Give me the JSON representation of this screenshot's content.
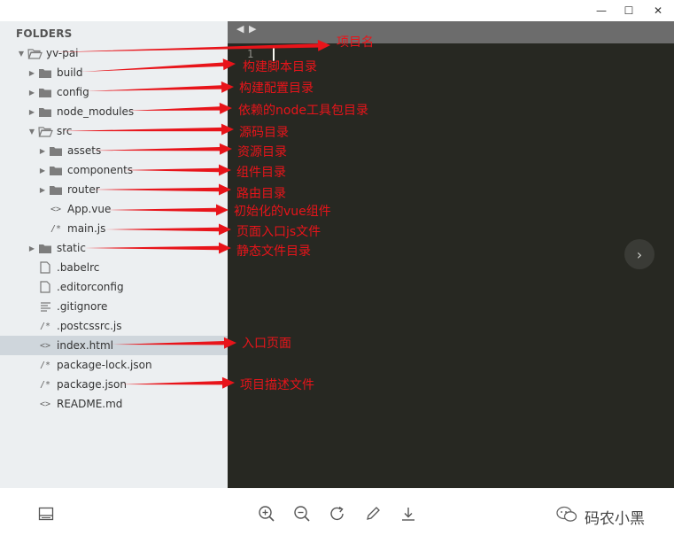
{
  "window": {
    "minimize_glyph": "—",
    "maximize_glyph": "☐",
    "close_glyph": "✕"
  },
  "sidebar": {
    "title": "FOLDERS",
    "items": [
      {
        "label": "yv-pai",
        "kind": "folder-open",
        "depth": 0
      },
      {
        "label": "build",
        "kind": "folder",
        "depth": 1
      },
      {
        "label": "config",
        "kind": "folder",
        "depth": 1
      },
      {
        "label": "node_modules",
        "kind": "folder",
        "depth": 1
      },
      {
        "label": "src",
        "kind": "folder-open",
        "depth": 1
      },
      {
        "label": "assets",
        "kind": "folder",
        "depth": 2
      },
      {
        "label": "components",
        "kind": "folder",
        "depth": 2
      },
      {
        "label": "router",
        "kind": "folder",
        "depth": 2
      },
      {
        "label": "App.vue",
        "kind": "markup",
        "depth": 2
      },
      {
        "label": "main.js",
        "kind": "script",
        "depth": 2
      },
      {
        "label": "static",
        "kind": "folder",
        "depth": 1
      },
      {
        "label": ".babelrc",
        "kind": "file",
        "depth": 1
      },
      {
        "label": ".editorconfig",
        "kind": "file",
        "depth": 1
      },
      {
        "label": ".gitignore",
        "kind": "text",
        "depth": 1
      },
      {
        "label": ".postcssrc.js",
        "kind": "script",
        "depth": 1
      },
      {
        "label": "index.html",
        "kind": "markup",
        "depth": 1,
        "selected": true
      },
      {
        "label": "package-lock.json",
        "kind": "script",
        "depth": 1
      },
      {
        "label": "package.json",
        "kind": "script",
        "depth": 1
      },
      {
        "label": "README.md",
        "kind": "markup",
        "depth": 1
      }
    ]
  },
  "editor": {
    "nav_back": "◀",
    "nav_forward": "▶",
    "line_number": "1",
    "next_button_glyph": "›"
  },
  "toolbar": {
    "icons": [
      "layout-icon",
      "zoom-in-icon",
      "zoom-out-icon",
      "rotate-icon",
      "edit-icon",
      "download-icon"
    ]
  },
  "watermark": {
    "text": "码农小黑"
  },
  "annotations": [
    {
      "text": "项目名"
    },
    {
      "text": "构建脚本目录"
    },
    {
      "text": "构建配置目录"
    },
    {
      "text": "依赖的node工具包目录"
    },
    {
      "text": "源码目录"
    },
    {
      "text": "资源目录"
    },
    {
      "text": "组件目录"
    },
    {
      "text": "路由目录"
    },
    {
      "text": "初始化的vue组件"
    },
    {
      "text": "页面入口js文件"
    },
    {
      "text": "静态文件目录"
    },
    {
      "text": "入口页面"
    },
    {
      "text": "项目描述文件"
    }
  ],
  "colors": {
    "sidebar_bg": "#eceff1",
    "selected_row": "#cfd6dc",
    "editor_bg": "#272822",
    "tabbar_bg": "#6c6c6c",
    "annotation_red": "#e8141a"
  }
}
